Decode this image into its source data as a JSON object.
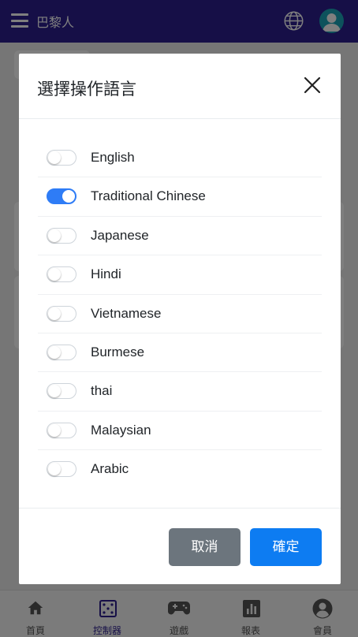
{
  "topbar": {
    "title": "巴黎人"
  },
  "colors": {
    "topbar": "#2c1f8f",
    "toggle_on": "#2e7cf6",
    "cancel": "#6c757d",
    "confirm": "#0d7cf2"
  },
  "bottom_nav": [
    {
      "label": "首頁",
      "icon": "home-icon",
      "active": false
    },
    {
      "label": "控制器",
      "icon": "controller-icon",
      "active": true
    },
    {
      "label": "遊戲",
      "icon": "gamepad-icon",
      "active": false
    },
    {
      "label": "報表",
      "icon": "chart-icon",
      "active": false
    },
    {
      "label": "會員",
      "icon": "member-icon",
      "active": false
    }
  ],
  "modal": {
    "title": "選擇操作語言",
    "languages": [
      {
        "label": "English",
        "on": false
      },
      {
        "label": "Traditional Chinese",
        "on": true
      },
      {
        "label": "Japanese",
        "on": false
      },
      {
        "label": "Hindi",
        "on": false
      },
      {
        "label": "Vietnamese",
        "on": false
      },
      {
        "label": "Burmese",
        "on": false
      },
      {
        "label": "thai",
        "on": false
      },
      {
        "label": "Malaysian",
        "on": false
      },
      {
        "label": "Arabic",
        "on": false
      }
    ],
    "cancel_label": "取消",
    "confirm_label": "確定"
  }
}
